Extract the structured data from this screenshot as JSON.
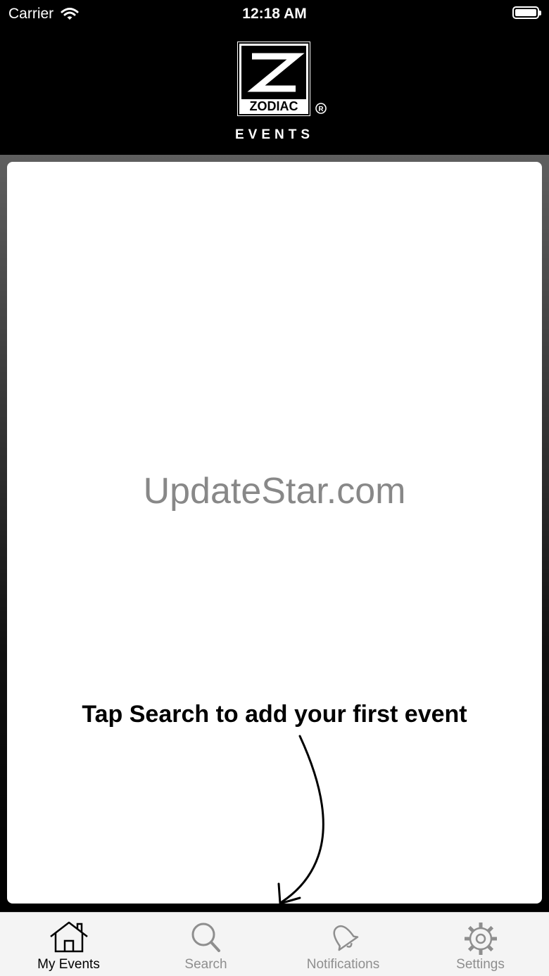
{
  "status_bar": {
    "carrier": "Carrier",
    "time": "12:18 AM"
  },
  "header": {
    "brand": "ZODIAC",
    "subtitle": "EVENTS",
    "registered_mark": "®"
  },
  "main": {
    "watermark": "UpdateStar.com",
    "empty_hint": "Tap Search to add your first event"
  },
  "tabbar": {
    "tabs": [
      {
        "label": "My Events",
        "icon": "home-icon",
        "active": true
      },
      {
        "label": "Search",
        "icon": "search-icon",
        "active": false
      },
      {
        "label": "Notifications",
        "icon": "bell-icon",
        "active": false
      },
      {
        "label": "Settings",
        "icon": "gear-icon",
        "active": false
      }
    ]
  },
  "colors": {
    "header_bg": "#000000",
    "active_tab": "#000000",
    "inactive_tab": "#8e8e8e"
  }
}
